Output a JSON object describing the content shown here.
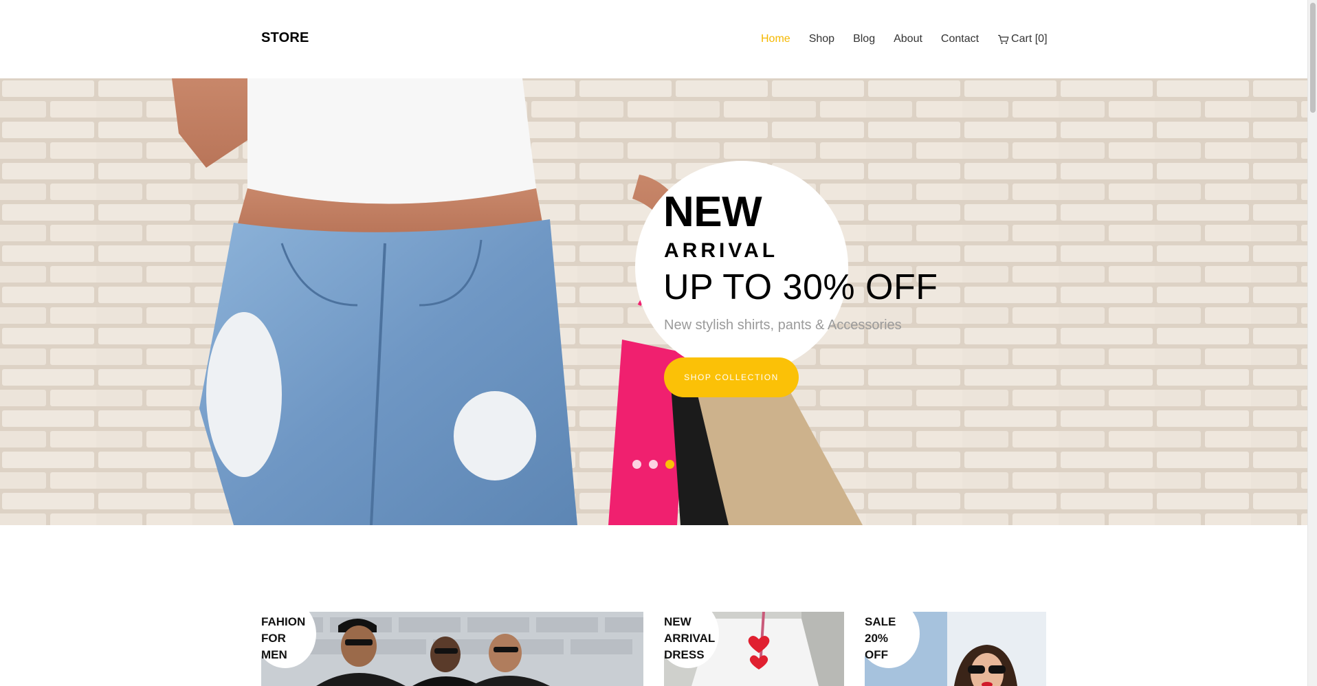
{
  "header": {
    "logo": "STORE",
    "nav": [
      {
        "label": "Home",
        "active": true
      },
      {
        "label": "Shop",
        "active": false
      },
      {
        "label": "Blog",
        "active": false
      },
      {
        "label": "About",
        "active": false
      },
      {
        "label": "Contact",
        "active": false
      }
    ],
    "cart_label": "Cart [0]",
    "cart_icon": "shopping-cart-icon"
  },
  "hero": {
    "title": "NEW",
    "subtitle": "ARRIVAL",
    "offer": "UP TO 30% OFF",
    "description": "New stylish shirts, pants & Accessories",
    "button_label": "SHOP COLLECTION",
    "slides_total": 3,
    "active_slide": 3
  },
  "categories": [
    {
      "label_lines": [
        "FAHION",
        "FOR",
        "MEN"
      ]
    },
    {
      "label_lines": [
        "NEW",
        "ARRIVAL",
        "DRESS"
      ]
    },
    {
      "label_lines": [
        "SALE",
        "20%",
        "OFF"
      ]
    }
  ],
  "colors": {
    "accent": "#fbc107",
    "nav_active": "#f5b800",
    "text": "#333333",
    "muted": "#9a9a9a"
  }
}
